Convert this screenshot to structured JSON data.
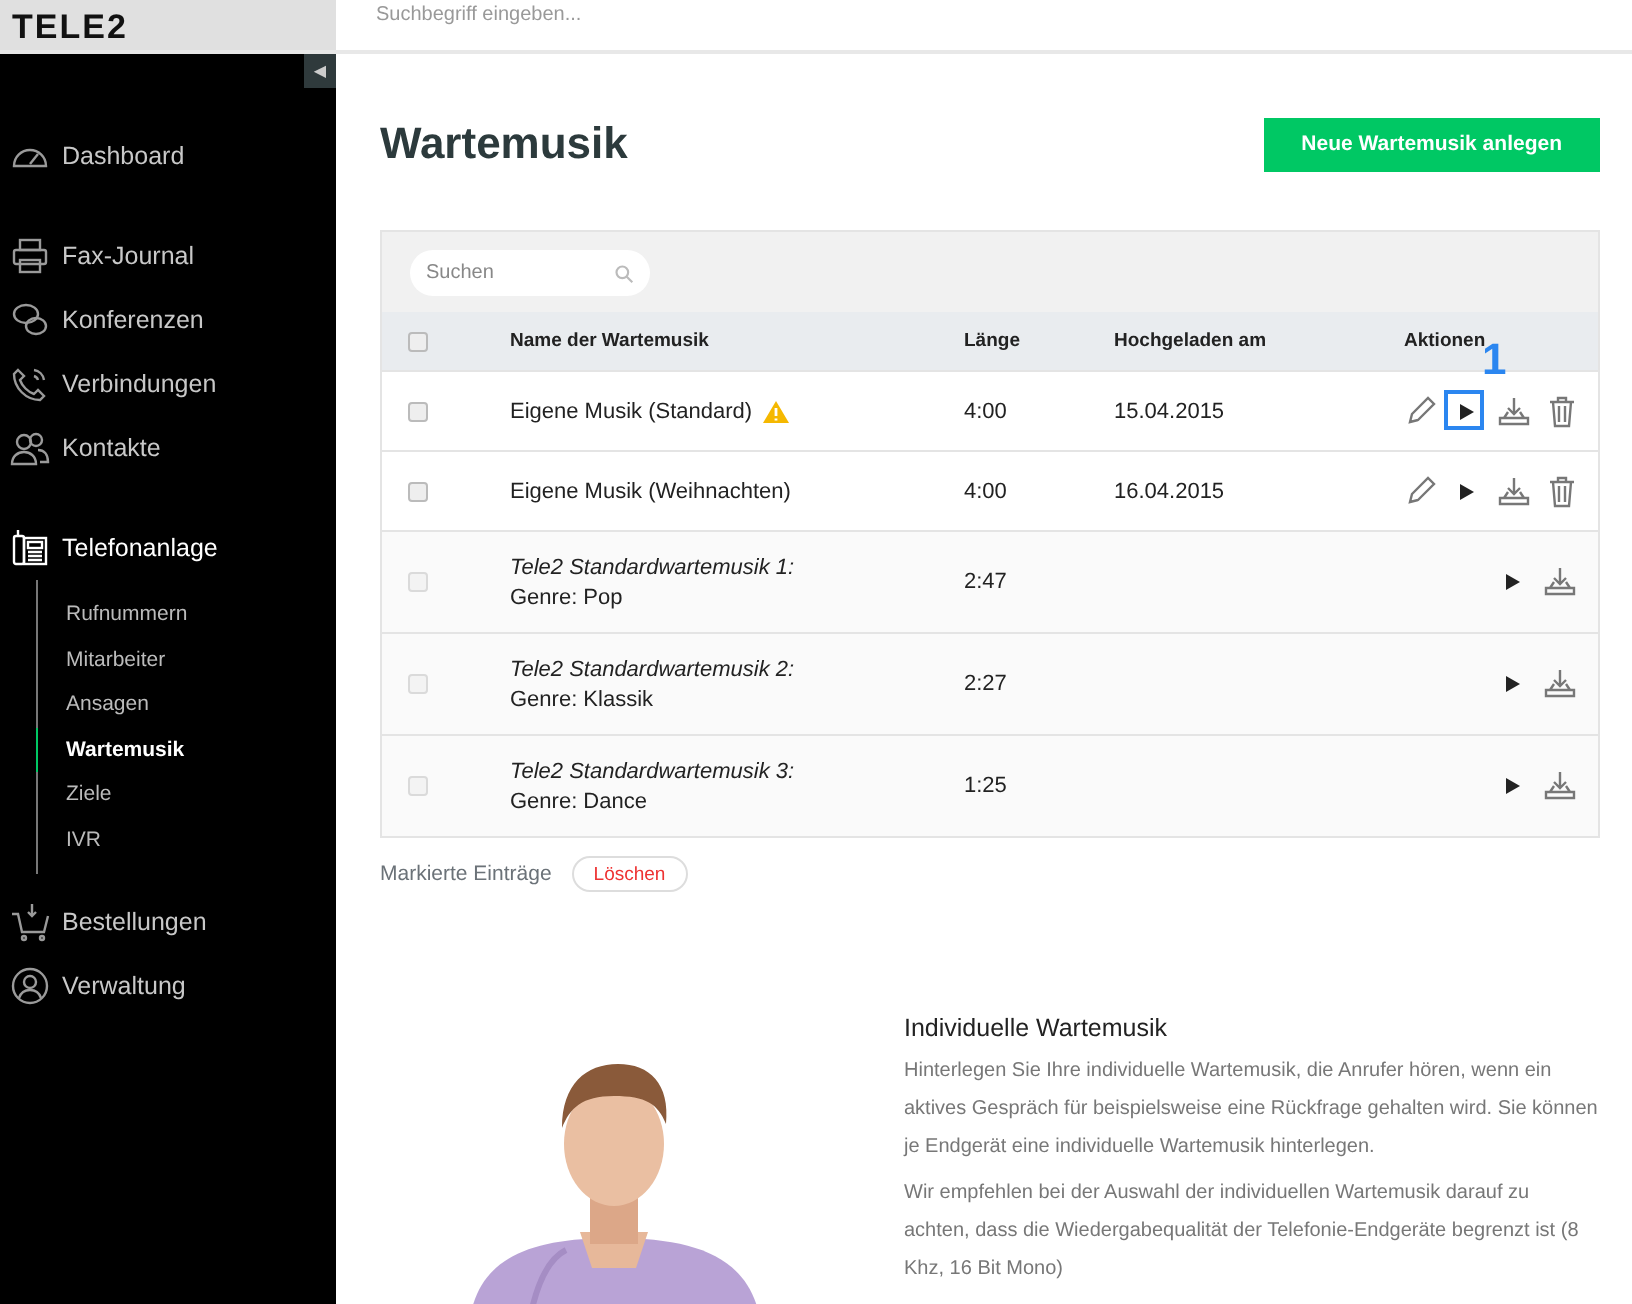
{
  "header": {
    "logo": "TELE2",
    "search": {
      "placeholder": "Suchbegriff eingeben..."
    },
    "collapse_toggle": "◀"
  },
  "sidebar": {
    "sections": [
      [
        {
          "label": "Dashboard",
          "selected": false
        }
      ],
      [
        {
          "label": "Fax-Journal",
          "selected": false
        },
        {
          "label": "Konferenzen",
          "selected": false
        },
        {
          "label": "Verbindungen",
          "selected": false
        },
        {
          "label": "Kontakte",
          "selected": false
        }
      ],
      [
        {
          "label": "Telefonanlage",
          "selected": true,
          "children": [
            {
              "label": "Rufnummern",
              "selected": false
            },
            {
              "label": "Mitarbeiter",
              "selected": false
            },
            {
              "label": "Ansagen",
              "selected": false
            },
            {
              "label": "Wartemusik",
              "selected": true
            },
            {
              "label": "Ziele",
              "selected": false
            },
            {
              "label": "IVR",
              "selected": false
            }
          ]
        },
        {
          "label": "Bestellungen",
          "selected": false
        },
        {
          "label": "Verwaltung",
          "selected": false
        }
      ]
    ]
  },
  "page": {
    "title": "Wartemusik",
    "primary_button": "Neue Wartemusik anlegen"
  },
  "table": {
    "search": {
      "placeholder": "Suchen"
    },
    "columns": [
      "Name der Wartemusik",
      "Länge",
      "Hochgeladen am",
      "Aktionen"
    ],
    "header_checked": false,
    "rows": [
      {
        "kind": "custom",
        "name": "Eigene Musik (Standard)",
        "warning": true,
        "length": "4:00",
        "uploaded": "15.04.2015",
        "checked": false,
        "callout": "1"
      },
      {
        "kind": "custom",
        "name": "Eigene Musik (Weihnachten)",
        "length": "4:00",
        "uploaded": "16.04.2015",
        "checked": false
      },
      {
        "kind": "standard",
        "name": "Tele2 Standardwartemusik 1:",
        "genre": "Genre: Pop",
        "length": "2:47",
        "checked": false
      },
      {
        "kind": "standard",
        "name": "Tele2 Standardwartemusik 2:",
        "genre": "Genre: Klassik",
        "length": "2:27",
        "checked": false
      },
      {
        "kind": "standard",
        "name": "Tele2 Standardwartemusik 3:",
        "genre": "Genre: Dance",
        "length": "1:25",
        "checked": false
      }
    ],
    "bulk_label": "Markierte Einträge",
    "bulk_button": "Löschen"
  },
  "info": {
    "picture": {
      "kind": "picture"
    },
    "title": "Individuelle Wartemusik",
    "paragraphs": [
      "Hinterlegen Sie Ihre individuelle Wartemusik, die Anrufer hören, wenn ein aktives Gespräch für beispielsweise eine Rückfrage gehalten wird. Sie können je Endgerät eine individuelle Wartemusik hinterlegen.",
      "Wir empfehlen bei der Auswahl der individuellen Wartemusik darauf zu achten, dass die Wiedergabequalität der Telefonie-Endgeräte begrenzt ist (8 Khz, 16 Bit Mono)"
    ]
  }
}
